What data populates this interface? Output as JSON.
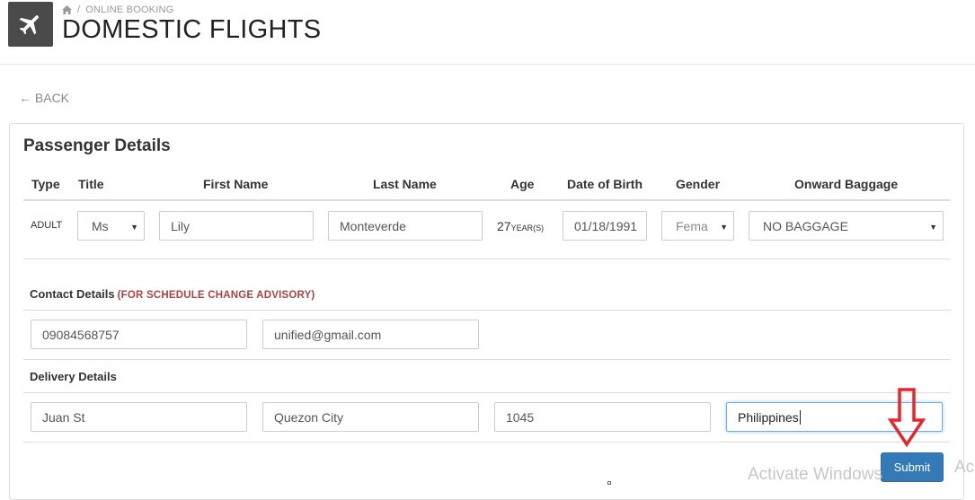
{
  "header": {
    "breadcrumb": "ONLINE BOOKING",
    "breadcrumb_separator": "/",
    "title": "DOMESTIC FLIGHTS",
    "logo_icon": "airplane-icon",
    "home_icon": "home-icon"
  },
  "back": {
    "label": "← BACK"
  },
  "passenger": {
    "section_title": "Passenger Details",
    "columns": [
      "Type",
      "Title",
      "First Name",
      "Last Name",
      "Age",
      "Date of Birth",
      "Gender",
      "Onward Baggage"
    ],
    "row": {
      "type": "ADULT",
      "title": "Ms",
      "first_name": "Lily",
      "last_name": "Monteverde",
      "age_value": "27",
      "age_unit": "YEAR(S)",
      "dob": "01/18/1991",
      "gender": "Fema",
      "baggage": "NO BAGGAGE"
    }
  },
  "contact": {
    "heading": "Contact Details",
    "note": "(FOR SCHEDULE CHANGE ADVISORY)",
    "phone": "09084568757",
    "email": "unified@gmail.com"
  },
  "delivery": {
    "heading": "Delivery Details",
    "street": "Juan St",
    "city": "Quezon City",
    "zip": "1045",
    "country": "Philippines"
  },
  "actions": {
    "submit_label": "Submit"
  },
  "overlay": {
    "watermark": "Activate Windows",
    "watermark_partial": "Ac",
    "annotation_color": "#e8262a"
  },
  "colors": {
    "logo_bg": "#4a4a4a",
    "primary": "#337ab7",
    "advisory": "#a94442"
  }
}
